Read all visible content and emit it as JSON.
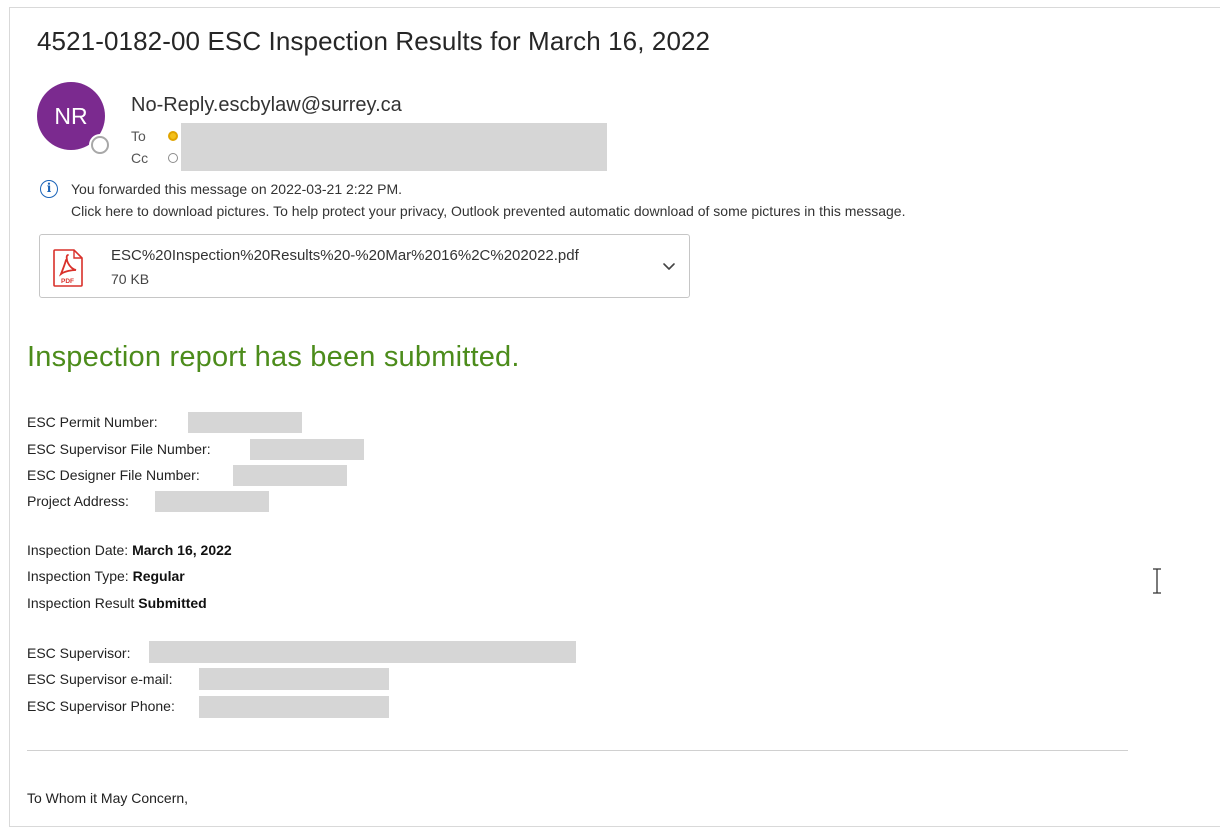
{
  "message": {
    "subject": "4521-0182-00 ESC Inspection Results for March 16, 2022",
    "avatar_initials": "NR",
    "sender": "No-Reply.escbylaw@surrey.ca",
    "to_label": "To",
    "cc_label": "Cc"
  },
  "infobar": {
    "forwarded": "You forwarded this message on 2022-03-21 2:22 PM.",
    "pictures": "Click here to download pictures. To help protect your privacy, Outlook prevented automatic download of some pictures in this message."
  },
  "attachment": {
    "name": "ESC%20Inspection%20Results%20-%20Mar%2016%2C%202022.pdf",
    "size": "70 KB",
    "icon": "pdf-icon",
    "icon_label": "PDF"
  },
  "body": {
    "heading": "Inspection report has been submitted.",
    "fields": {
      "permit_number": "ESC Permit Number:",
      "supervisor_file_number": "ESC Supervisor File Number:",
      "designer_file_number": "ESC Designer File Number:",
      "project_address": "Project Address:"
    },
    "inspection": {
      "date_label": "Inspection Date: ",
      "date_value": "March 16, 2022",
      "type_label": "Inspection Type: ",
      "type_value": "Regular",
      "result_label": "Inspection Result ",
      "result_value": "Submitted"
    },
    "supervisor": {
      "name_label": "ESC Supervisor:",
      "email_label": "ESC Supervisor e-mail:",
      "phone_label": "ESC Supervisor Phone:"
    },
    "salutation": "To Whom it May Concern,"
  },
  "colors": {
    "avatar": "#7b2a8f",
    "heading_green": "#4c8c1b",
    "info_blue": "#1b64b8",
    "pdf_red": "#d9302a",
    "redaction": "#d6d6d6"
  }
}
